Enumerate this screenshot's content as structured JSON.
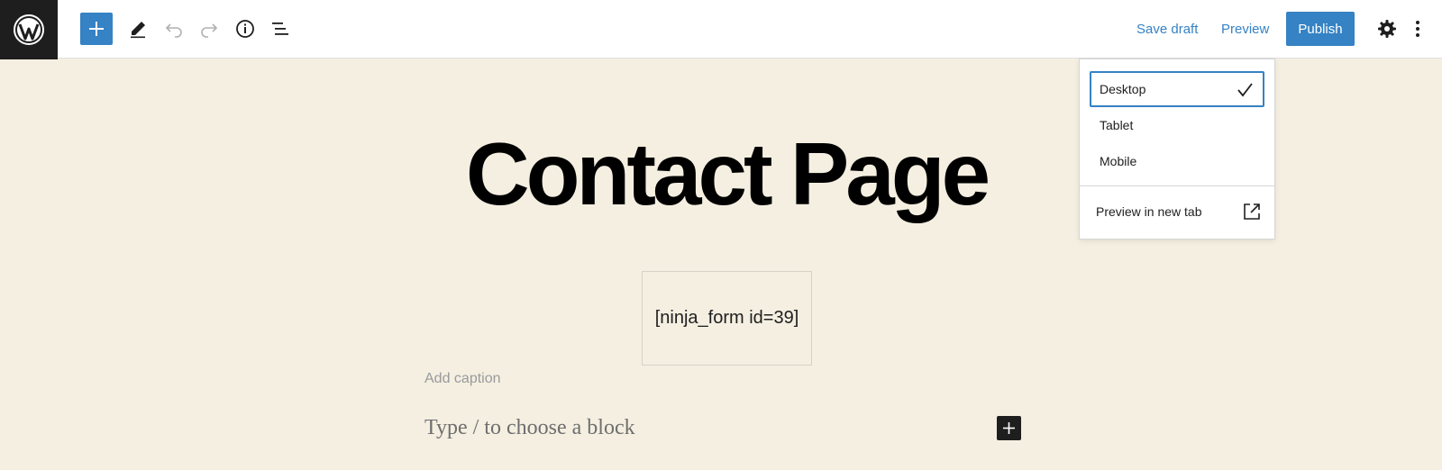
{
  "toolbar": {
    "add_block_icon": "plus-icon",
    "tools_icon": "pencil-icon",
    "undo_icon": "undo-icon",
    "redo_icon": "redo-icon",
    "details_icon": "info-icon",
    "list_view_icon": "list-view-icon",
    "save_draft_label": "Save draft",
    "preview_label": "Preview",
    "publish_label": "Publish",
    "settings_icon": "gear-icon",
    "options_icon": "more-vertical-icon",
    "accent_color": "#3582c4"
  },
  "preview_menu": {
    "options": [
      {
        "label": "Desktop",
        "selected": true
      },
      {
        "label": "Tablet",
        "selected": false
      },
      {
        "label": "Mobile",
        "selected": false
      }
    ],
    "new_tab_label": "Preview in new tab",
    "new_tab_icon": "external-link-icon"
  },
  "content": {
    "title": "Contact Page",
    "shortcode": "[ninja_form id=39]",
    "caption_placeholder": "Add caption",
    "block_placeholder": "Type / to choose a block",
    "background_color": "#f4efe1"
  }
}
